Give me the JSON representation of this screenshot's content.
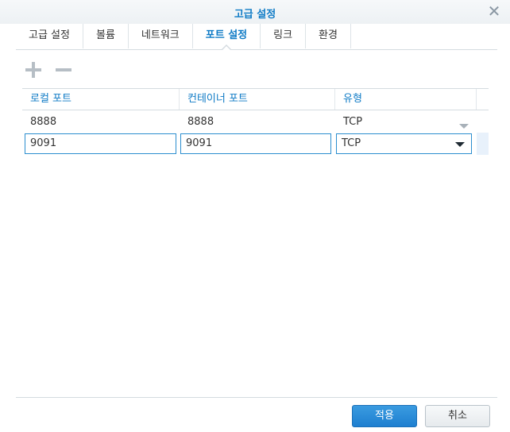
{
  "window": {
    "title": "고급 설정"
  },
  "tabs": [
    {
      "label": "고급 설정",
      "active": false
    },
    {
      "label": "볼륨",
      "active": false
    },
    {
      "label": "네트워크",
      "active": false
    },
    {
      "label": "포트 설정",
      "active": true
    },
    {
      "label": "링크",
      "active": false
    },
    {
      "label": "환경",
      "active": false
    }
  ],
  "toolbar": {
    "add_icon": "plus-icon",
    "remove_icon": "minus-icon"
  },
  "grid": {
    "columns": [
      "로컬 포트",
      "컨테이너 포트",
      "유형"
    ],
    "rows": [
      {
        "local_port": "8888",
        "container_port": "8888",
        "type": "TCP"
      },
      {
        "local_port": "9091",
        "container_port": "9091",
        "type": "TCP"
      }
    ]
  },
  "footer": {
    "apply_label": "적용",
    "cancel_label": "취소"
  },
  "colors": {
    "accent": "#0f7bc6",
    "primary_button": "#2a8bd8",
    "edit_border": "#2b8ecf"
  }
}
